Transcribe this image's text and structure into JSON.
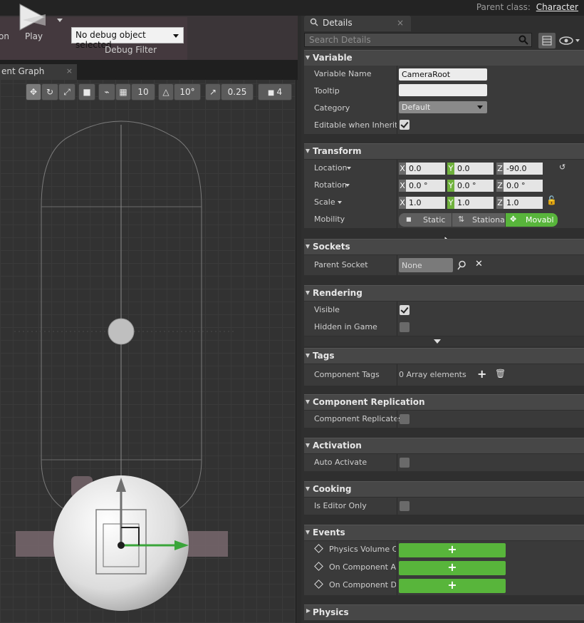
{
  "top": {
    "parent_class_label": "Parent class:",
    "parent_class_value": "Character"
  },
  "toolbar": {
    "left_partial_label": "on",
    "play_label": "Play",
    "debug_select_value": "No debug object selected",
    "debug_filter_label": "Debug Filter"
  },
  "graph_tab": {
    "label": "ent Graph",
    "close": "×"
  },
  "viewport_toolbar": {
    "grid_snap": "10",
    "rotation_snap": "10°",
    "scale_snap": "0.25",
    "camera_speed": "4"
  },
  "details": {
    "tab_label": "Details",
    "tab_close": "×",
    "search_placeholder": "Search Details",
    "categories": {
      "variable": "Variable",
      "transform": "Transform",
      "sockets": "Sockets",
      "rendering": "Rendering",
      "tags": "Tags",
      "component_replication": "Component Replication",
      "activation": "Activation",
      "cooking": "Cooking",
      "events": "Events",
      "physics": "Physics"
    },
    "variable": {
      "name_label": "Variable Name",
      "name_value": "CameraRoot",
      "tooltip_label": "Tooltip",
      "tooltip_value": "",
      "category_label": "Category",
      "category_value": "Default",
      "editable_label": "Editable when Inherited",
      "editable_checked": true
    },
    "transform": {
      "location_label": "Location",
      "location": {
        "x": "0.0",
        "y": "0.0",
        "z": "-90.0"
      },
      "rotation_label": "Rotation",
      "rotation": {
        "x": "0.0 °",
        "y": "0.0 °",
        "z": "0.0 °"
      },
      "scale_label": "Scale",
      "scale": {
        "x": "1.0",
        "y": "1.0",
        "z": "1.0"
      },
      "mobility_label": "Mobility",
      "mobility_options": [
        "Static",
        "Stationa",
        "Movabl"
      ],
      "mobility_selected": "Movabl"
    },
    "sockets": {
      "parent_socket_label": "Parent Socket",
      "parent_socket_value": "None"
    },
    "rendering": {
      "visible_label": "Visible",
      "visible_checked": true,
      "hidden_label": "Hidden in Game",
      "hidden_checked": false
    },
    "tags": {
      "component_tags_label": "Component Tags",
      "component_tags_value": "0 Array elements"
    },
    "component_replication": {
      "replicates_label": "Component Replicates"
    },
    "activation": {
      "auto_activate_label": "Auto Activate"
    },
    "cooking": {
      "editor_only_label": "Is Editor Only"
    },
    "events": {
      "items": [
        "Physics Volume Ch",
        "On Component Act",
        "On Component Dea"
      ],
      "add_symbol": "+"
    },
    "axis_labels": {
      "x": "X",
      "y": "Y",
      "z": "Z"
    }
  },
  "colors": {
    "accent_green": "#58b53b",
    "axis_y_green": "#6fb13c",
    "panel_bg": "#2f2f2f"
  }
}
